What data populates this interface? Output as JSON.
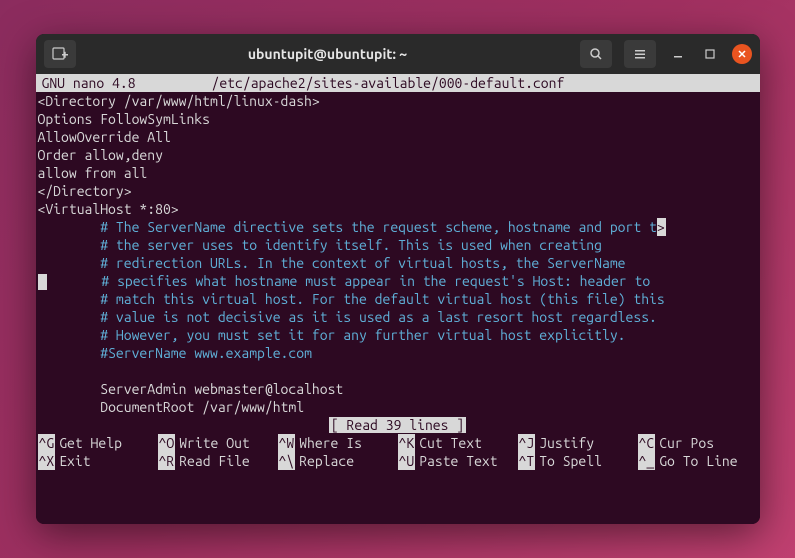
{
  "window": {
    "title": "ubuntupit@ubuntupit: ~"
  },
  "nano": {
    "version": "  GNU nano 4.8",
    "filepath": "/etc/apache2/sites-available/000-default.conf"
  },
  "content": {
    "lines": [
      "<Directory /var/www/html/linux-dash>",
      "Options FollowSymLinks",
      "AllowOverride All",
      "Order allow,deny",
      "allow from all",
      "</Directory>",
      "",
      "",
      "<VirtualHost *:80>"
    ],
    "comments": [
      "# The ServerName directive sets the request scheme, hostname and port t",
      "# the server uses to identify itself. This is used when creating",
      "# redirection URLs. In the context of virtual hosts, the ServerName",
      "# specifies what hostname must appear in the request's Host: header to",
      "# match this virtual host. For the default virtual host (this file) this",
      "# value is not decisive as it is used as a last resort host regardless.",
      "# However, you must set it for any further virtual host explicitly.",
      "#ServerName www.example.com"
    ],
    "post": [
      "ServerAdmin webmaster@localhost",
      "DocumentRoot /var/www/html"
    ]
  },
  "status": "[ Read 39 lines ]",
  "shortcuts": {
    "row1": [
      {
        "key": "^G",
        "label": "Get Help"
      },
      {
        "key": "^O",
        "label": "Write Out"
      },
      {
        "key": "^W",
        "label": "Where Is"
      },
      {
        "key": "^K",
        "label": "Cut Text"
      },
      {
        "key": "^J",
        "label": "Justify"
      },
      {
        "key": "^C",
        "label": "Cur Pos"
      }
    ],
    "row2": [
      {
        "key": "^X",
        "label": "Exit"
      },
      {
        "key": "^R",
        "label": "Read File"
      },
      {
        "key": "^\\",
        "label": "Replace"
      },
      {
        "key": "^U",
        "label": "Paste Text"
      },
      {
        "key": "^T",
        "label": "To Spell"
      },
      {
        "key": "^_",
        "label": "Go To Line"
      }
    ]
  }
}
